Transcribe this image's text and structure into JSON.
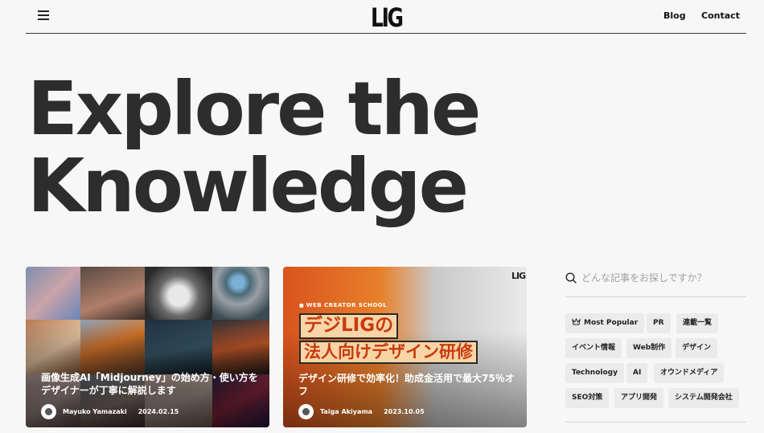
{
  "header": {
    "logo": "LIG",
    "nav": [
      {
        "label": "Blog"
      },
      {
        "label": "Contact"
      }
    ]
  },
  "hero": {
    "line1": "Explore the",
    "line2": "Knowledge"
  },
  "articles": [
    {
      "title": "画像生成AI「Midjourney」の始め方・使い方をデザイナーが丁寧に解説します",
      "author": "Mayuko Yamazaki",
      "date": "2024.02.15"
    },
    {
      "title": "デザイン研修で効率化！助成金活用で最大75％オフ",
      "author": "Taiga Akiyama",
      "date": "2023.10.05",
      "image_text": {
        "school": "WEB CREATOR SCHOOL",
        "headline1": "デジLIGの",
        "headline2": "法人向けデザイン研修",
        "logo": "LIG"
      }
    }
  ],
  "search": {
    "placeholder": "どんな記事をお探しですか？"
  },
  "tags": [
    {
      "label": "Most Popular",
      "icon": "crown-icon"
    },
    {
      "label": "PR"
    },
    {
      "label": "連載一覧"
    },
    {
      "label": "イベント情報"
    },
    {
      "label": "Web制作"
    },
    {
      "label": "デザイン"
    },
    {
      "label": "Technology"
    },
    {
      "label": "AI"
    },
    {
      "label": "オウンドメディア"
    },
    {
      "label": "SEO対策"
    },
    {
      "label": "アプリ開発"
    },
    {
      "label": "システム開発会社"
    }
  ]
}
